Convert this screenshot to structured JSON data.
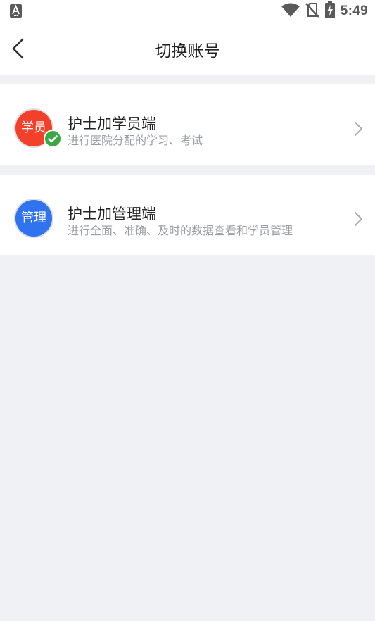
{
  "status_bar": {
    "time": "5:49",
    "icons": [
      "text-a-icon",
      "wifi-icon",
      "no-sim-icon",
      "battery-charging-icon"
    ]
  },
  "header": {
    "title": "切换账号",
    "back_icon": "chevron-left-icon"
  },
  "accounts": [
    {
      "avatar_text": "学员",
      "avatar_color": "#f3402b",
      "title": "护士加学员端",
      "description": "进行医院分配的学习、考试",
      "selected": true,
      "badge_color": "#3aa845"
    },
    {
      "avatar_text": "管理",
      "avatar_color": "#2f73ee",
      "title": "护士加管理端",
      "description": "进行全面、准确、及时的数据查看和学员管理",
      "selected": false
    }
  ],
  "colors": {
    "background": "#f0f1f5",
    "card": "#ffffff",
    "muted_text": "#9a9ca4"
  }
}
